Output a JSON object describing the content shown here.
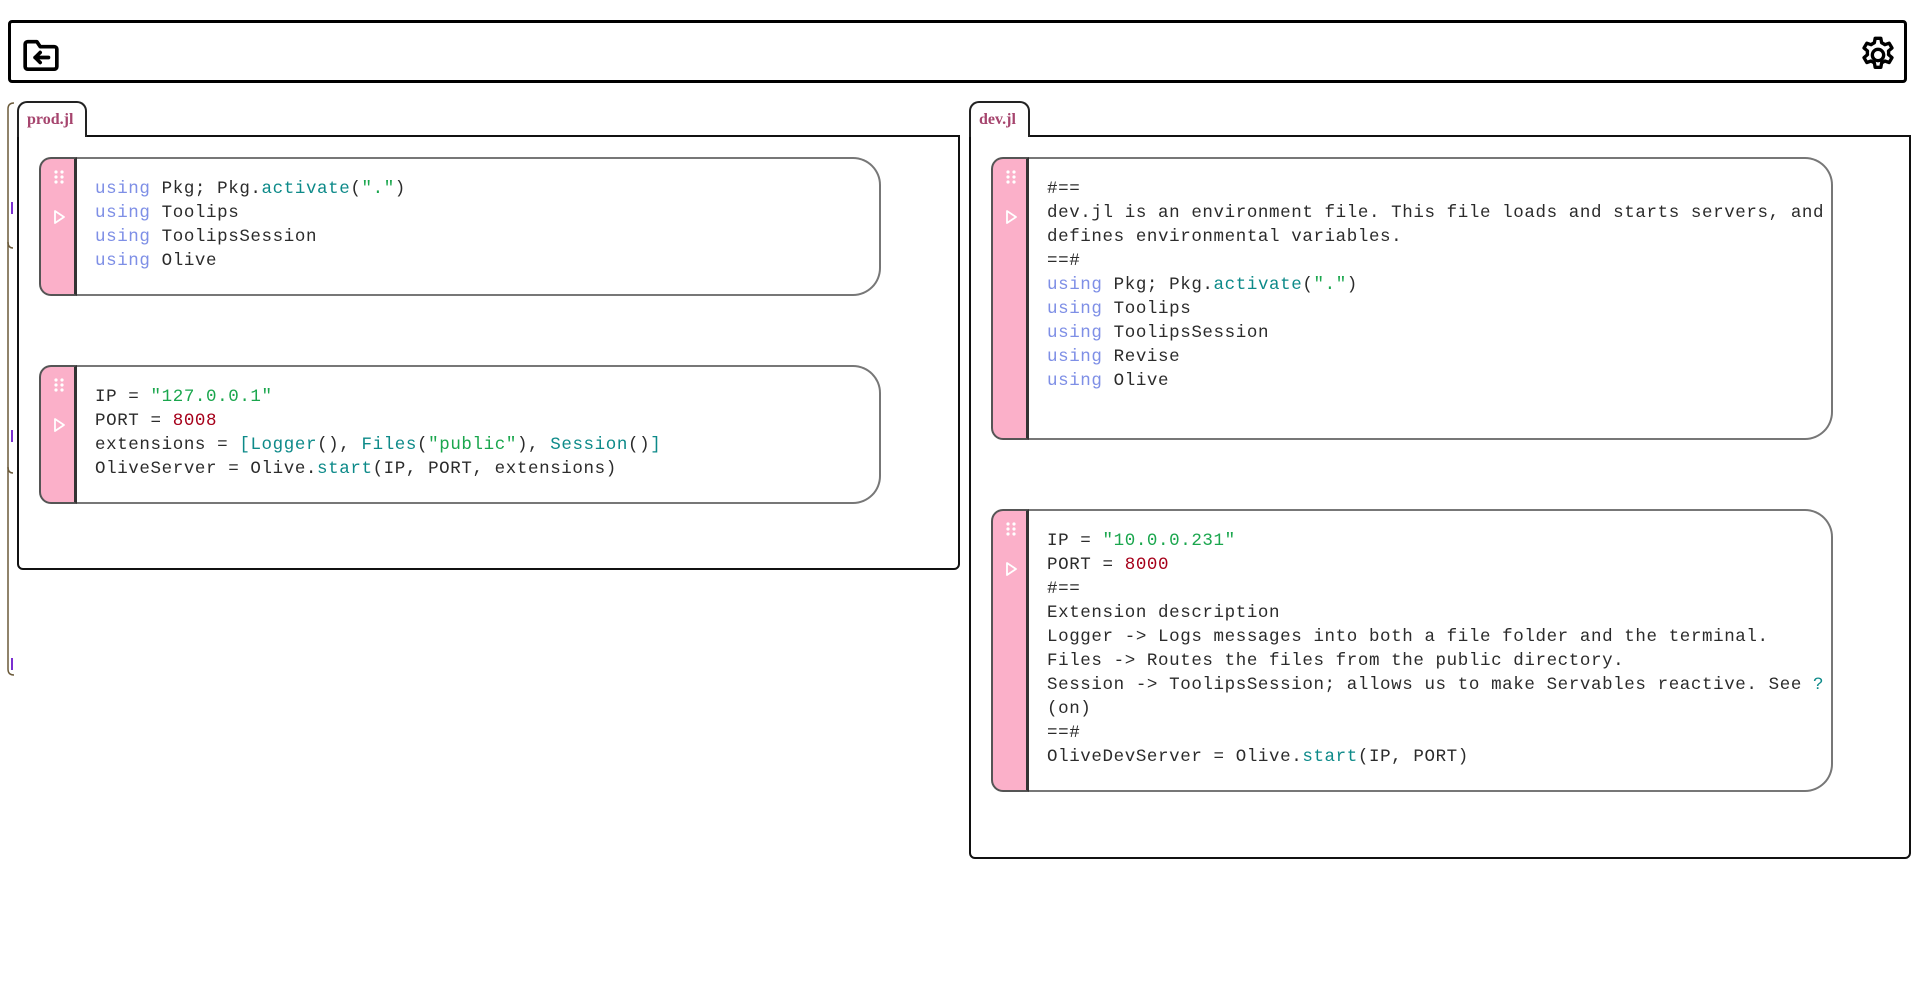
{
  "projects": [
    {
      "tab": "prod.jl",
      "cells": [
        [
          [
            [
              "kw",
              "using"
            ],
            [
              "t",
              " Pkg; Pkg."
            ],
            [
              "fn",
              "activate"
            ],
            [
              "t",
              "("
            ],
            [
              "str",
              "\".\""
            ],
            [
              "t",
              ")"
            ]
          ],
          [
            [
              "kw",
              "using"
            ],
            [
              "t",
              " Toolips"
            ]
          ],
          [
            [
              "kw",
              "using"
            ],
            [
              "t",
              " ToolipsSession"
            ]
          ],
          [
            [
              "kw",
              "using"
            ],
            [
              "t",
              " Olive"
            ]
          ]
        ],
        [
          [
            [
              "t",
              "IP = "
            ],
            [
              "str",
              "\"127.0.0.1\""
            ]
          ],
          [
            [
              "t",
              "PORT = "
            ],
            [
              "num",
              "8008"
            ]
          ],
          [
            [
              "t",
              "extensions = "
            ],
            [
              "fn",
              "["
            ],
            [
              "fn",
              "Logger"
            ],
            [
              "t",
              "(), "
            ],
            [
              "fn",
              "Files"
            ],
            [
              "t",
              "("
            ],
            [
              "str",
              "\"public\""
            ],
            [
              "t",
              "), "
            ],
            [
              "fn",
              "Session"
            ],
            [
              "t",
              "()"
            ],
            [
              "fn",
              "]"
            ]
          ],
          [
            [
              "t",
              "OliveServer = Olive."
            ],
            [
              "fn",
              "start"
            ],
            [
              "t",
              "(IP, PORT, extensions)"
            ]
          ]
        ]
      ]
    },
    {
      "tab": "dev.jl",
      "cells": [
        [
          [
            [
              "t",
              "#=="
            ]
          ],
          [
            [
              "t",
              "dev.jl is an environment file. This file loads and starts servers, and"
            ]
          ],
          [
            [
              "t",
              "defines environmental variables."
            ]
          ],
          [
            [
              "t",
              "==#"
            ]
          ],
          [
            [
              "kw",
              "using"
            ],
            [
              "t",
              " Pkg; Pkg."
            ],
            [
              "fn",
              "activate"
            ],
            [
              "t",
              "("
            ],
            [
              "str",
              "\".\""
            ],
            [
              "t",
              ")"
            ]
          ],
          [
            [
              "kw",
              "using"
            ],
            [
              "t",
              " Toolips"
            ]
          ],
          [
            [
              "kw",
              "using"
            ],
            [
              "t",
              " ToolipsSession"
            ]
          ],
          [
            [
              "kw",
              "using"
            ],
            [
              "t",
              " Revise"
            ]
          ],
          [
            [
              "kw",
              "using"
            ],
            [
              "t",
              " Olive"
            ]
          ]
        ],
        [
          [
            [
              "t",
              "IP = "
            ],
            [
              "str",
              "\"10.0.0.231\""
            ]
          ],
          [
            [
              "t",
              "PORT = "
            ],
            [
              "num",
              "8000"
            ]
          ],
          [
            [
              "t",
              "#=="
            ]
          ],
          [
            [
              "t",
              "Extension description"
            ]
          ],
          [
            [
              "t",
              "Logger -> Logs messages into both a file folder and the terminal."
            ]
          ],
          [
            [
              "t",
              "Files -> Routes the files from the public directory."
            ]
          ],
          [
            [
              "t",
              "Session -> ToolipsSession; allows us to make Servables reactive. See "
            ],
            [
              "fn",
              "?"
            ]
          ],
          [
            [
              "t",
              "(on)"
            ]
          ],
          [
            [
              "t",
              "==#"
            ]
          ],
          [
            [
              "t",
              "OliveDevServer = Olive."
            ],
            [
              "fn",
              "start"
            ],
            [
              "t",
              "(IP, PORT)"
            ]
          ]
        ]
      ]
    }
  ],
  "icons": {
    "back": "folder-back-icon",
    "settings": "gear-icon",
    "drag": "drag-grip-icon",
    "run": "run-play-icon"
  },
  "colors": {
    "cell_side": "#fbb0c9",
    "tab_text": "#a6456e",
    "keyword": "#7e8fe6",
    "function": "#0d8a89",
    "string": "#1aa64d",
    "number": "#a6001a"
  }
}
